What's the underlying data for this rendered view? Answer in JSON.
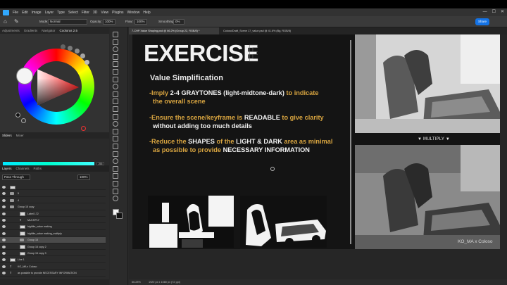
{
  "menubar": {
    "items": [
      "File",
      "Edit",
      "Image",
      "Layer",
      "Type",
      "Select",
      "Filter",
      "3D",
      "View",
      "Plugins",
      "Window",
      "Help"
    ],
    "window_controls": [
      "—",
      "☐",
      "✕"
    ]
  },
  "options": {
    "mode_label": "Mode:",
    "mode_value": "Normal",
    "opacity_label": "Opacity:",
    "opacity_value": "100%",
    "flow_label": "Flow:",
    "flow_value": "100%",
    "smoothing_label": "Smoothing:",
    "smoothing_value": "0%",
    "share_label": "Share"
  },
  "left_tabs": [
    "Adjustments",
    "Gradients",
    "Navigator",
    "Coolorus 2.5"
  ],
  "color": {
    "foreground": "#f4f4f4",
    "slider_values": [
      "255",
      "255",
      "255"
    ],
    "hex_row": "HSB  HEX  LAB  CMYK  RGB",
    "slider_tabs": [
      "Sliders",
      "Mixer"
    ]
  },
  "layers": {
    "tabs": [
      "Layers",
      "Channels",
      "Paths"
    ],
    "blend": "Pass Through",
    "opacity": "100%",
    "rows": [
      {
        "name": "",
        "type": "layer"
      },
      {
        "name": "5",
        "type": "folder"
      },
      {
        "name": "4",
        "type": "folder"
      },
      {
        "name": "Group 15 copy",
        "type": "folder"
      },
      {
        "name": "Label 172",
        "type": "layer"
      },
      {
        "name": "MULTIPLY",
        "type": "text"
      },
      {
        "name": "highlite_value making",
        "type": "layer"
      },
      {
        "name": "highlite_value making_multiply",
        "type": "layer"
      },
      {
        "name": "Group 15",
        "type": "folder"
      },
      {
        "name": "Group 15 copy 2",
        "type": "layer"
      },
      {
        "name": "Group 15 copy 3",
        "type": "layer"
      },
      {
        "name": "Line 1",
        "type": "layer"
      },
      {
        "name": "KO_MA x Coloso",
        "type": "text"
      },
      {
        "name": "as possible to provide NECESSARY INFORMATION",
        "type": "text"
      }
    ]
  },
  "tabs": {
    "active": "7-CHP-Value Shaping.psd @ 66.2% (Group 22, RGB/8) *",
    "inactive": "Coloso/Draft_Scene 17_value.psd @ 41.6% (Bg, RGB/8)"
  },
  "status": {
    "zoom": "66.28%",
    "size": "1920 px x 1080 px (72 ppi)"
  },
  "slide": {
    "title": "EXERCISE",
    "ghost": "E",
    "subtitle": "Value Simplification",
    "b1_a": "-Imply ",
    "b1_b": "2-4 GRAYTONES (light-midtone-dark)",
    "b1_c": " to indicate",
    "b1_d": "the overall scene",
    "b2_a": "-Ensure the scene/keyframe is ",
    "b2_b": "READABLE",
    "b2_c": " to give clarity",
    "b2_d": "without adding too much details",
    "b3_a": "-Reduce the ",
    "b3_b": "SHAPES",
    "b3_c": " of the ",
    "b3_d": "LIGHT & DARK",
    "b3_e": " area as minimal",
    "b3_f": "as possible to provide ",
    "b3_g": "NECESSARY INFORMATION",
    "multiply_label": "▼ MULTIPLY ▼",
    "credit": "KO_MA x Coloso"
  },
  "colors": {
    "accent_orange": "#d9a540",
    "share_blue": "#1473e6"
  }
}
